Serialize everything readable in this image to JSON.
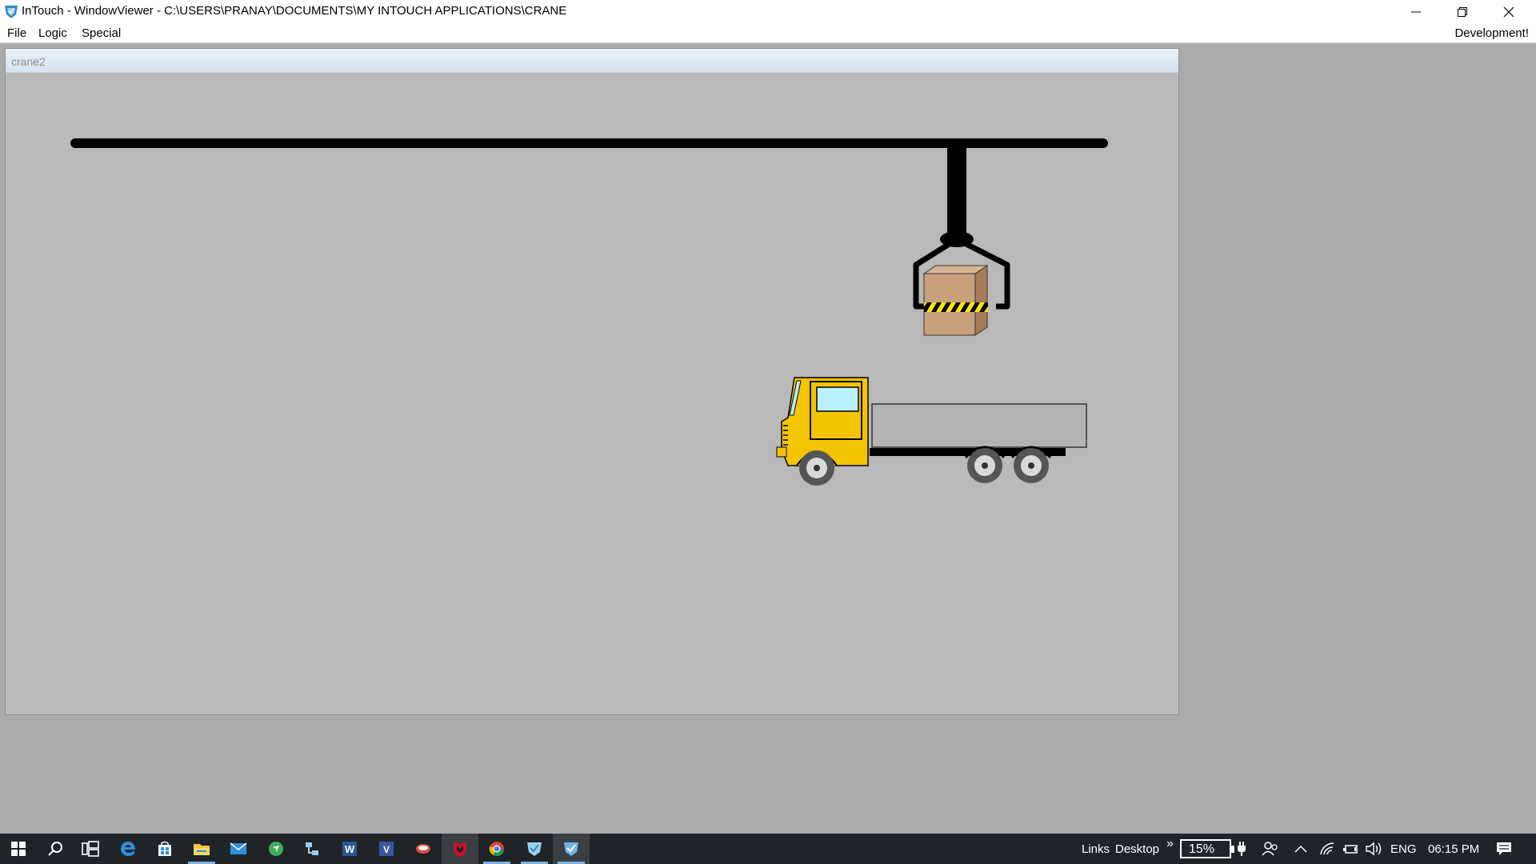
{
  "window": {
    "title": "InTouch - WindowViewer - C:\\USERS\\PRANAY\\DOCUMENTS\\MY INTOUCH APPLICATIONS\\CRANE",
    "controls": [
      "minimize-icon",
      "restore-icon",
      "close-icon"
    ]
  },
  "menu": {
    "items": [
      "File",
      "Logic",
      "Special"
    ],
    "right_label": "Development!"
  },
  "child_window": {
    "title": "crane2"
  },
  "scene": {
    "truck_cab_color": "#f5c400",
    "cargo_color": "#c9a07c",
    "trailer_color": "#b3b3b3",
    "hazard_stripe_colors": [
      "#ffe600",
      "#000000"
    ]
  },
  "taskbar": {
    "apps": [
      "windows-start-icon",
      "search-icon",
      "task-view-icon",
      "edge-icon",
      "store-icon",
      "file-explorer-icon",
      "mail-icon",
      "vpn-icon",
      "network-tool-icon",
      "word-icon",
      "visio-icon",
      "app-icon",
      "mcafee-icon",
      "chrome-icon",
      "intouch-manager-icon",
      "intouch-viewer-icon"
    ],
    "links_label": "Links",
    "desktop_label": "Desktop",
    "chevron": "»",
    "battery": "15%",
    "language": "ENG",
    "time": "06:15 PM"
  }
}
